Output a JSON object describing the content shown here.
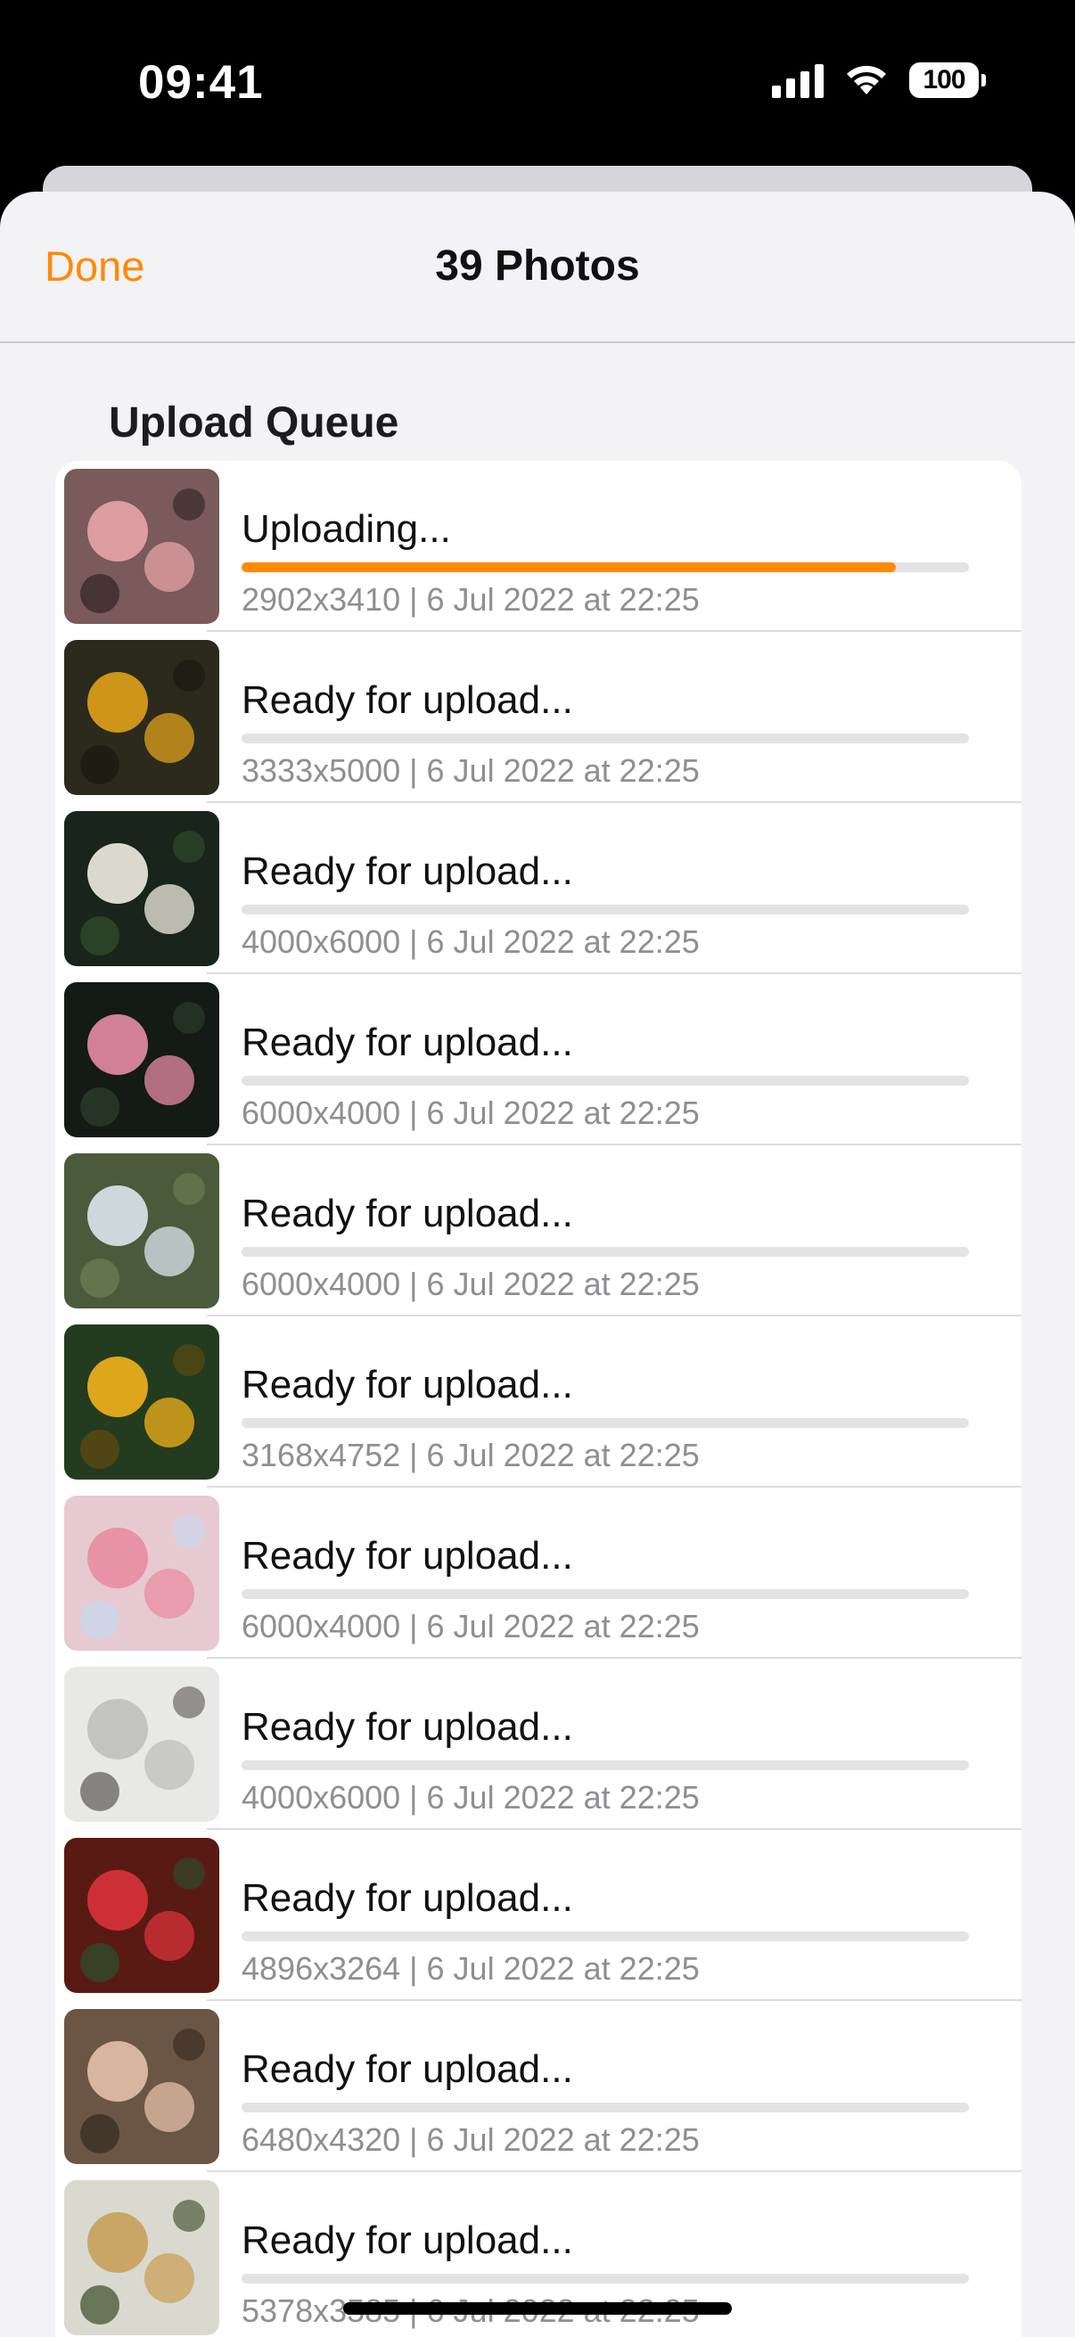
{
  "status_bar": {
    "time": "09:41",
    "battery": "100",
    "signal_icon": "signal-icon",
    "wifi_icon": "wifi-icon",
    "battery_icon": "battery-icon"
  },
  "nav": {
    "done_label": "Done",
    "title": "39 Photos"
  },
  "section": {
    "title": "Upload Queue"
  },
  "accent_color": "#ff8a00",
  "items": [
    {
      "status": "Uploading...",
      "meta": "2902x3410 | 6 Jul 2022 at 22:25",
      "progress": 0.9
    },
    {
      "status": "Ready for upload...",
      "meta": "3333x5000 | 6 Jul 2022 at 22:25",
      "progress": 0
    },
    {
      "status": "Ready for upload...",
      "meta": "4000x6000 | 6 Jul 2022 at 22:25",
      "progress": 0
    },
    {
      "status": "Ready for upload...",
      "meta": "6000x4000 | 6 Jul 2022 at 22:25",
      "progress": 0
    },
    {
      "status": "Ready for upload...",
      "meta": "6000x4000 | 6 Jul 2022 at 22:25",
      "progress": 0
    },
    {
      "status": "Ready for upload...",
      "meta": "3168x4752 | 6 Jul 2022 at 22:25",
      "progress": 0
    },
    {
      "status": "Ready for upload...",
      "meta": "6000x4000 | 6 Jul 2022 at 22:25",
      "progress": 0
    },
    {
      "status": "Ready for upload...",
      "meta": "4000x6000 | 6 Jul 2022 at 22:25",
      "progress": 0
    },
    {
      "status": "Ready for upload...",
      "meta": "4896x3264 | 6 Jul 2022 at 22:25",
      "progress": 0
    },
    {
      "status": "Ready for upload...",
      "meta": "6480x4320 | 6 Jul 2022 at 22:25",
      "progress": 0
    },
    {
      "status": "Ready for upload...",
      "meta": "5378x3585 | 6 Jul 2022 at 22:25",
      "progress": 0
    }
  ]
}
